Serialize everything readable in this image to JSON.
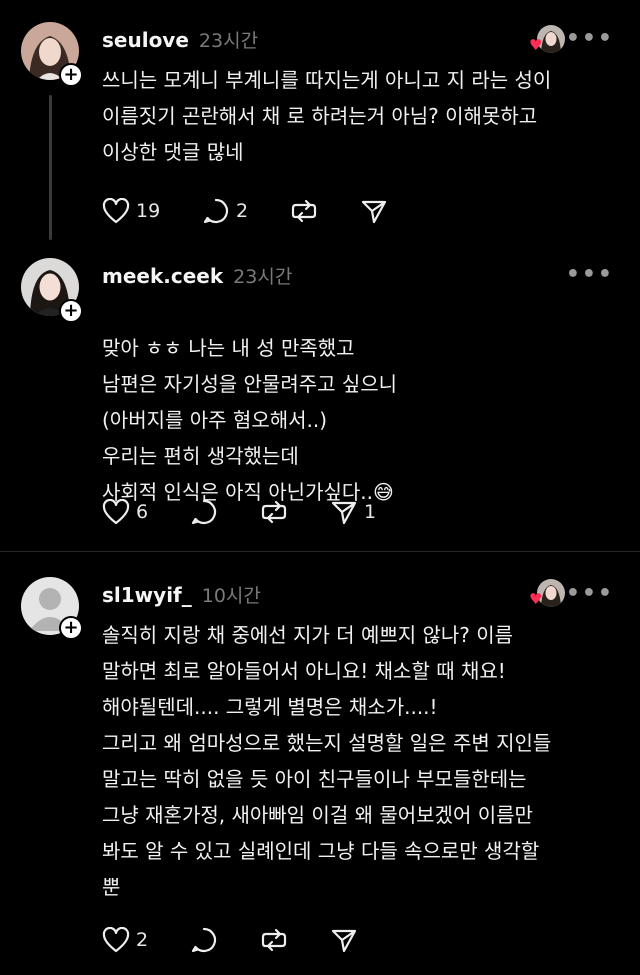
{
  "posts": [
    {
      "username": "seulove",
      "time": "23시간",
      "avatar": "woman-portrait-avatar",
      "text": "쓰니는 모계니 부계니를 따지는게 아니고 지 라는 성이\n이름짓기 곤란해서 채 로 하려는거 아님? 이해못하고\n이상한 댓글 많네",
      "likes": "19",
      "comments": "2",
      "reposts": "",
      "shares": "",
      "liked_by_author": true
    },
    {
      "username": "meek.ceek",
      "time": "23시간",
      "avatar": "woman-portrait-avatar",
      "text": "맞아 ㅎㅎ 나는 내 성 만족했고\n남편은 자기성을 안물려주고 싶으니\n(아버지를 아주 혐오해서..)\n우리는 편히 생각했는데\n사회적 인식은 아직 아닌가싶다..",
      "emoji": "😅",
      "likes": "6",
      "comments": "",
      "reposts": "",
      "shares": "1",
      "liked_by_author": false
    },
    {
      "username": "sl1wyif_",
      "time": "10시간",
      "avatar": "default-person-avatar",
      "text": "솔직히 지랑 채 중에선 지가 더 예쁘지 않나? 이름\n말하면 최로 알아들어서 아니요! 채소할 때 채요!\n해야될텐데.... 그렇게 별명은 채소가....!\n그리고 왜 엄마성으로 했는지 설명할 일은 주변 지인들\n말고는 딱히 없을 듯 아이 친구들이나 부모들한테는\n그냥 재혼가정, 새아빠임 이걸 왜 물어보겠어 이름만\n봐도 알 수 있고 실례인데 그냥 다들 속으로만 생각할\n뿐",
      "likes": "2",
      "comments": "",
      "reposts": "",
      "shares": "",
      "liked_by_author": true
    }
  ],
  "icons": {
    "more": "•••",
    "plus": "+",
    "heart_badge": "♥"
  },
  "colors": {
    "background": "#000000",
    "text": "#f1f1f1",
    "muted": "#7a7a7a",
    "heart": "#ff2d55"
  }
}
